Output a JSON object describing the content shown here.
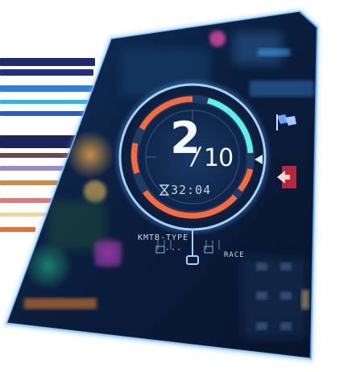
{
  "lap": {
    "current": "2",
    "total": "10",
    "slash": "/"
  },
  "timer": {
    "value": "32:04",
    "icon": "hourglass-icon"
  },
  "tags": {
    "left": "KMTB-TYPE",
    "right": "RACE"
  },
  "colors": {
    "ring_outer": "#5fa8ff",
    "arc_orange": "#ff6a3d",
    "arc_cyan": "#5ff0e8",
    "panel_edge": "#7fc3ff",
    "text": "#f4f8ff"
  }
}
